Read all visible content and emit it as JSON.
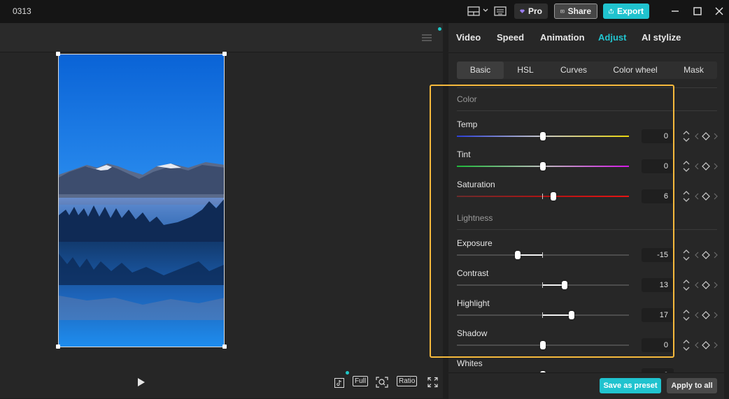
{
  "app": {
    "title": "0313"
  },
  "titlebar": {
    "pro_label": "Pro",
    "share_label": "Share",
    "export_label": "Export"
  },
  "player": {
    "bottom_buttons": {
      "full": "Full",
      "ratio": "Ratio"
    }
  },
  "tabs": [
    {
      "label": "Video",
      "active": false
    },
    {
      "label": "Speed",
      "active": false
    },
    {
      "label": "Animation",
      "active": false
    },
    {
      "label": "Adjust",
      "active": true
    },
    {
      "label": "AI stylize",
      "active": false
    }
  ],
  "subtabs": [
    {
      "label": "Basic",
      "active": true
    },
    {
      "label": "HSL",
      "active": false
    },
    {
      "label": "Curves",
      "active": false
    },
    {
      "label": "Color wheel",
      "active": false
    },
    {
      "label": "Mask",
      "active": false
    }
  ],
  "color_section": {
    "title": "Color",
    "params": [
      {
        "label": "Temp",
        "value": "0",
        "track": "temp"
      },
      {
        "label": "Tint",
        "value": "0",
        "track": "tint"
      },
      {
        "label": "Saturation",
        "value": "6",
        "track": "saturation"
      }
    ]
  },
  "lightness_section": {
    "title": "Lightness",
    "params": [
      {
        "label": "Exposure",
        "value": "-15"
      },
      {
        "label": "Contrast",
        "value": "13"
      },
      {
        "label": "Highlight",
        "value": "17"
      },
      {
        "label": "Shadow",
        "value": "0"
      },
      {
        "label": "Whites",
        "value": "0"
      }
    ]
  },
  "footer": {
    "save_preset": "Save as preset",
    "apply_all": "Apply to all"
  },
  "colors": {
    "accent": "#22c5d0",
    "highlight_box": "#f5b93c",
    "pro_gem": "#9b7cf0"
  }
}
